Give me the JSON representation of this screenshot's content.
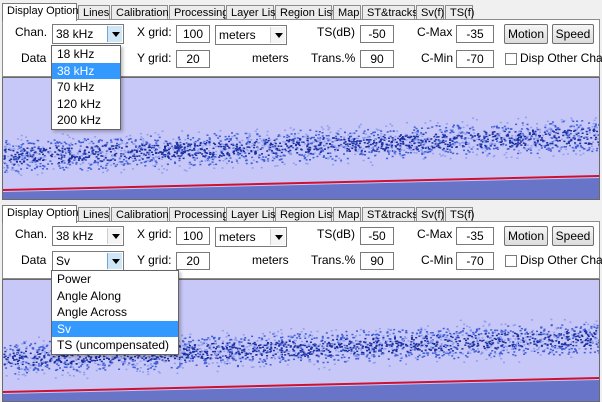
{
  "tabs": [
    "Display Option",
    "Lines",
    "Calibration",
    "Processing",
    "Layer List",
    "Region List",
    "Map",
    "ST&tracks",
    "Sv(f)",
    "TS(f)"
  ],
  "labels": {
    "chan": "Chan.",
    "data": "Data",
    "xgrid": "X grid:",
    "ygrid": "Y grid:",
    "meters": "meters",
    "ts": "TS(dB)",
    "trans": "Trans.%",
    "cmax": "C-Max",
    "cmin": "C-Min",
    "motion": "Motion",
    "speed": "Speed",
    "disp_other": "Disp Other Chan"
  },
  "top_panel": {
    "chan_value": "38 kHz",
    "data_value": "",
    "xgrid": "100",
    "ygrid": "20",
    "units_value": "meters",
    "ts": "-50",
    "trans": "90",
    "cmax": "-35",
    "cmin": "-70",
    "chan_options": [
      "18 kHz",
      "38 kHz",
      "70 kHz",
      "120 kHz",
      "200 kHz"
    ],
    "chan_selected_index": 1
  },
  "bottom_panel": {
    "chan_value": "38 kHz",
    "data_value": "Sv",
    "xgrid": "100",
    "ygrid": "20",
    "units_value": "meters",
    "ts": "-50",
    "trans": "90",
    "cmax": "-35",
    "cmin": "-70",
    "data_options": [
      "Power",
      "Angle Along",
      "Angle Across",
      "Sv",
      "TS (uncompensated)"
    ],
    "data_selected_index": 3
  },
  "colors": {
    "echogram_bg": "#c8c8f8",
    "echo_dark": "#1a2fa0",
    "echo_mid": "#3f5fd8",
    "echo_light": "#8f9fee",
    "bottom_line": "#d01030",
    "highlight": "#3399ff"
  },
  "icons": [
    "dropdown-arrow-icon",
    "checkbox-icon"
  ]
}
